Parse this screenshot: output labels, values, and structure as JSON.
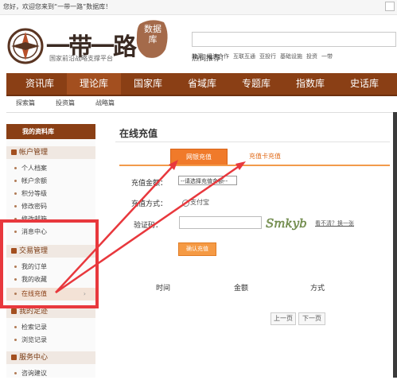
{
  "topbar": {
    "welcome": "您好，欢迎您来到“一带一路”数据库！"
  },
  "header": {
    "brand": "一带一路",
    "seal": "数据库",
    "tagline": "国家前沿战略支撑平台",
    "hot_label": "热词推荐：",
    "hot_words": [
      "能源",
      "经济合作",
      "互联互通",
      "亚投行",
      "基础设施",
      "投资",
      "一带"
    ]
  },
  "nav": {
    "items": [
      "资讯库",
      "理论库",
      "国家库",
      "省域库",
      "专题库",
      "指数库",
      "史话库"
    ]
  },
  "subnav": {
    "items": [
      "探索篇",
      "投资篇",
      "战略篇"
    ]
  },
  "sidebar": {
    "head": "我的资料库",
    "section_account": "帐户管理",
    "account_items": [
      "个人档案",
      "帐户余额",
      "积分等级",
      "修改密码",
      "修改邮箱",
      "消息中心"
    ],
    "section_trade": "交易管理",
    "trade_items": [
      "我的订单",
      "我的收藏",
      "在线充值"
    ],
    "chev": "›",
    "section_footprint": "我的足迹",
    "footprint_items": [
      "检索记录",
      "浏览记录"
    ],
    "section_service": "服务中心",
    "service_items": [
      "咨询建议"
    ]
  },
  "main": {
    "title": "在线充值",
    "tabs": [
      "网银充值",
      "充值卡充值"
    ],
    "amount_label": "充值金额：",
    "amount_value": "--请选择充值金额--",
    "method_label": "充值方式：",
    "method_value": "支付宝",
    "captcha_label": "验证码：",
    "captcha_text": "Smkyb",
    "refresh": "看不清？换一张",
    "submit": "确认充值",
    "columns": [
      "时间",
      "金额",
      "方式"
    ],
    "prev": "上一页",
    "next": "下一页"
  },
  "colors": {
    "brand_brown": "#8a3f15",
    "accent_orange": "#f07a2a",
    "highlight_red": "#e8383d"
  }
}
